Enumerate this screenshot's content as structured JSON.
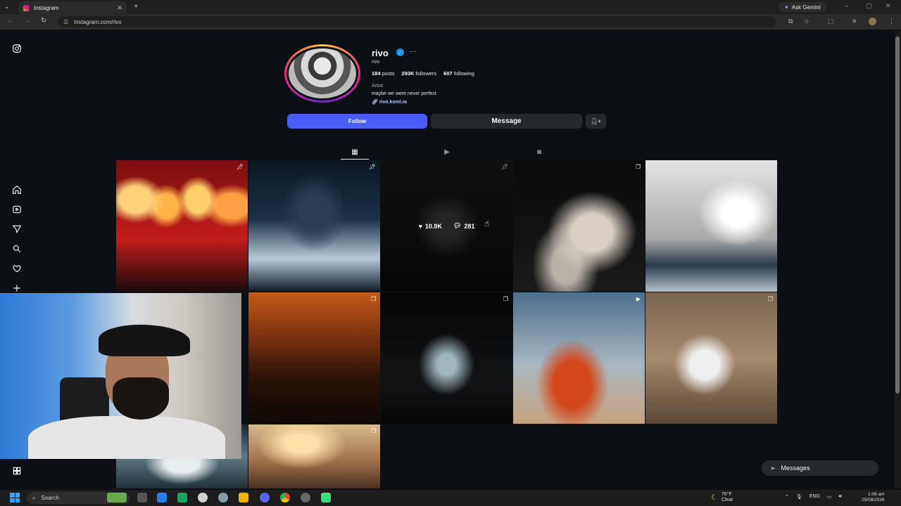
{
  "browser": {
    "tab_title": "Instagram",
    "tab_close": "✕",
    "new_tab": "+",
    "ask_gemini": "Ask Gemini",
    "url": "instagram.com/rivo"
  },
  "profile": {
    "username": "rivo",
    "verified_mark": "✓",
    "more": "···",
    "full_name": "rivo",
    "posts_count": "184",
    "posts_label": "posts",
    "followers_count": "293K",
    "followers_label": "followers",
    "following_count": "607",
    "following_label": "following",
    "category": "Artist",
    "bio": "maybe we were never perfect",
    "link": "rivo.komi.io",
    "follow_label": "Follow",
    "message_label": "Message"
  },
  "hover_post": {
    "likes": "10.9K",
    "comments": "281"
  },
  "messages_pill": {
    "label": "Messages"
  },
  "taskbar": {
    "search_label": "Search",
    "weather_temp": "76°F",
    "weather_desc": "Clear",
    "lang": "ENG",
    "time": "1:08 am",
    "date": "25/08/2026"
  },
  "colors": {
    "page_bg": "#0c1014",
    "follow_button": "#4a5df9",
    "secondary_button": "#25292e",
    "verified": "#0095f6"
  },
  "icons": [
    "instagram-icon",
    "home-icon",
    "reels-icon",
    "send-icon",
    "search-icon",
    "heart-icon",
    "plus-icon",
    "more-icon",
    "grid-icon",
    "reels-tab-icon",
    "tagged-icon",
    "pin-icon",
    "carousel-icon",
    "reel-icon",
    "messages-icon"
  ]
}
